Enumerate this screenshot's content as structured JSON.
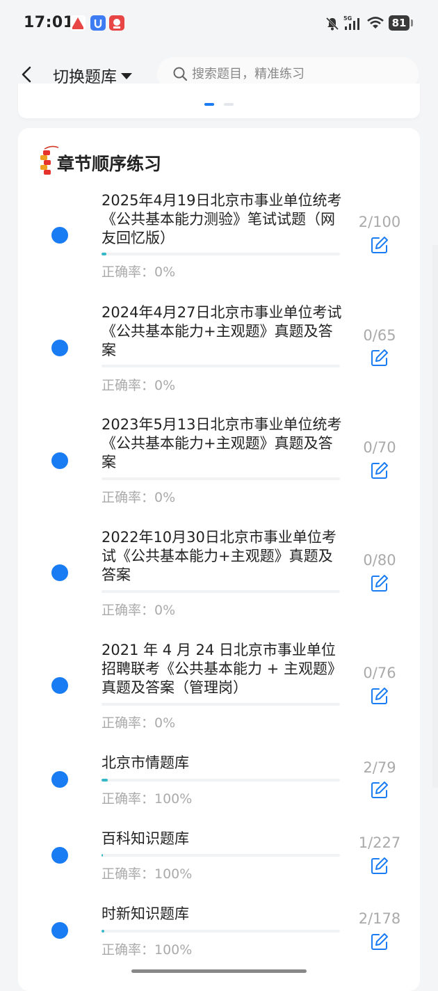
{
  "status_bar": {
    "time": "17:01",
    "network": "5G",
    "battery": "81",
    "icons": [
      "notification-app-icon",
      "security-app-icon",
      "red-app-icon",
      "bell-off-icon",
      "signal-icon",
      "wifi-icon",
      "battery-icon"
    ]
  },
  "header": {
    "back_icon": "chevron-left-icon",
    "bank_switch_label": "切换题库",
    "search_placeholder": "搜索题目，精准练习"
  },
  "chapter_section": {
    "title": "章节顺序练习",
    "accent_color": "#1a7cf2",
    "progress_color": "#37b8c9",
    "items": [
      {
        "title": "2025年4月19日北京市事业单位统考《公共基本能力测验》笔试试题（网友回忆版）",
        "accuracy": "正确率：0%",
        "count": "2/100",
        "progress": 0.02
      },
      {
        "title": "2024年4月27日北京市事业单位考试《公共基本能力+主观题》真题及答案",
        "accuracy": "正确率：0%",
        "count": "0/65",
        "progress": 0
      },
      {
        "title": "2023年5月13日北京市事业单位统考《公共基本能力+主观题》真题及答案",
        "accuracy": "正确率：0%",
        "count": "0/70",
        "progress": 0
      },
      {
        "title": "2022年10月30日北京市事业单位考试《公共基本能力+主观题》真题及答案",
        "accuracy": "正确率：0%",
        "count": "0/80",
        "progress": 0
      },
      {
        "title": "2021 年 4 月 24 日北京市事业单位招聘联考《公共基本能力 + 主观题》真题及答案（管理岗）",
        "accuracy": "正确率：0%",
        "count": "0/76",
        "progress": 0
      },
      {
        "title": "北京市情题库",
        "accuracy": "正确率：100%",
        "count": "2/79",
        "progress": 0.025
      },
      {
        "title": "百科知识题库",
        "accuracy": "正确率：100%",
        "count": "1/227",
        "progress": 0.005
      },
      {
        "title": "时新知识题库",
        "accuracy": "正确率：100%",
        "count": "2/178",
        "progress": 0.011
      }
    ]
  }
}
